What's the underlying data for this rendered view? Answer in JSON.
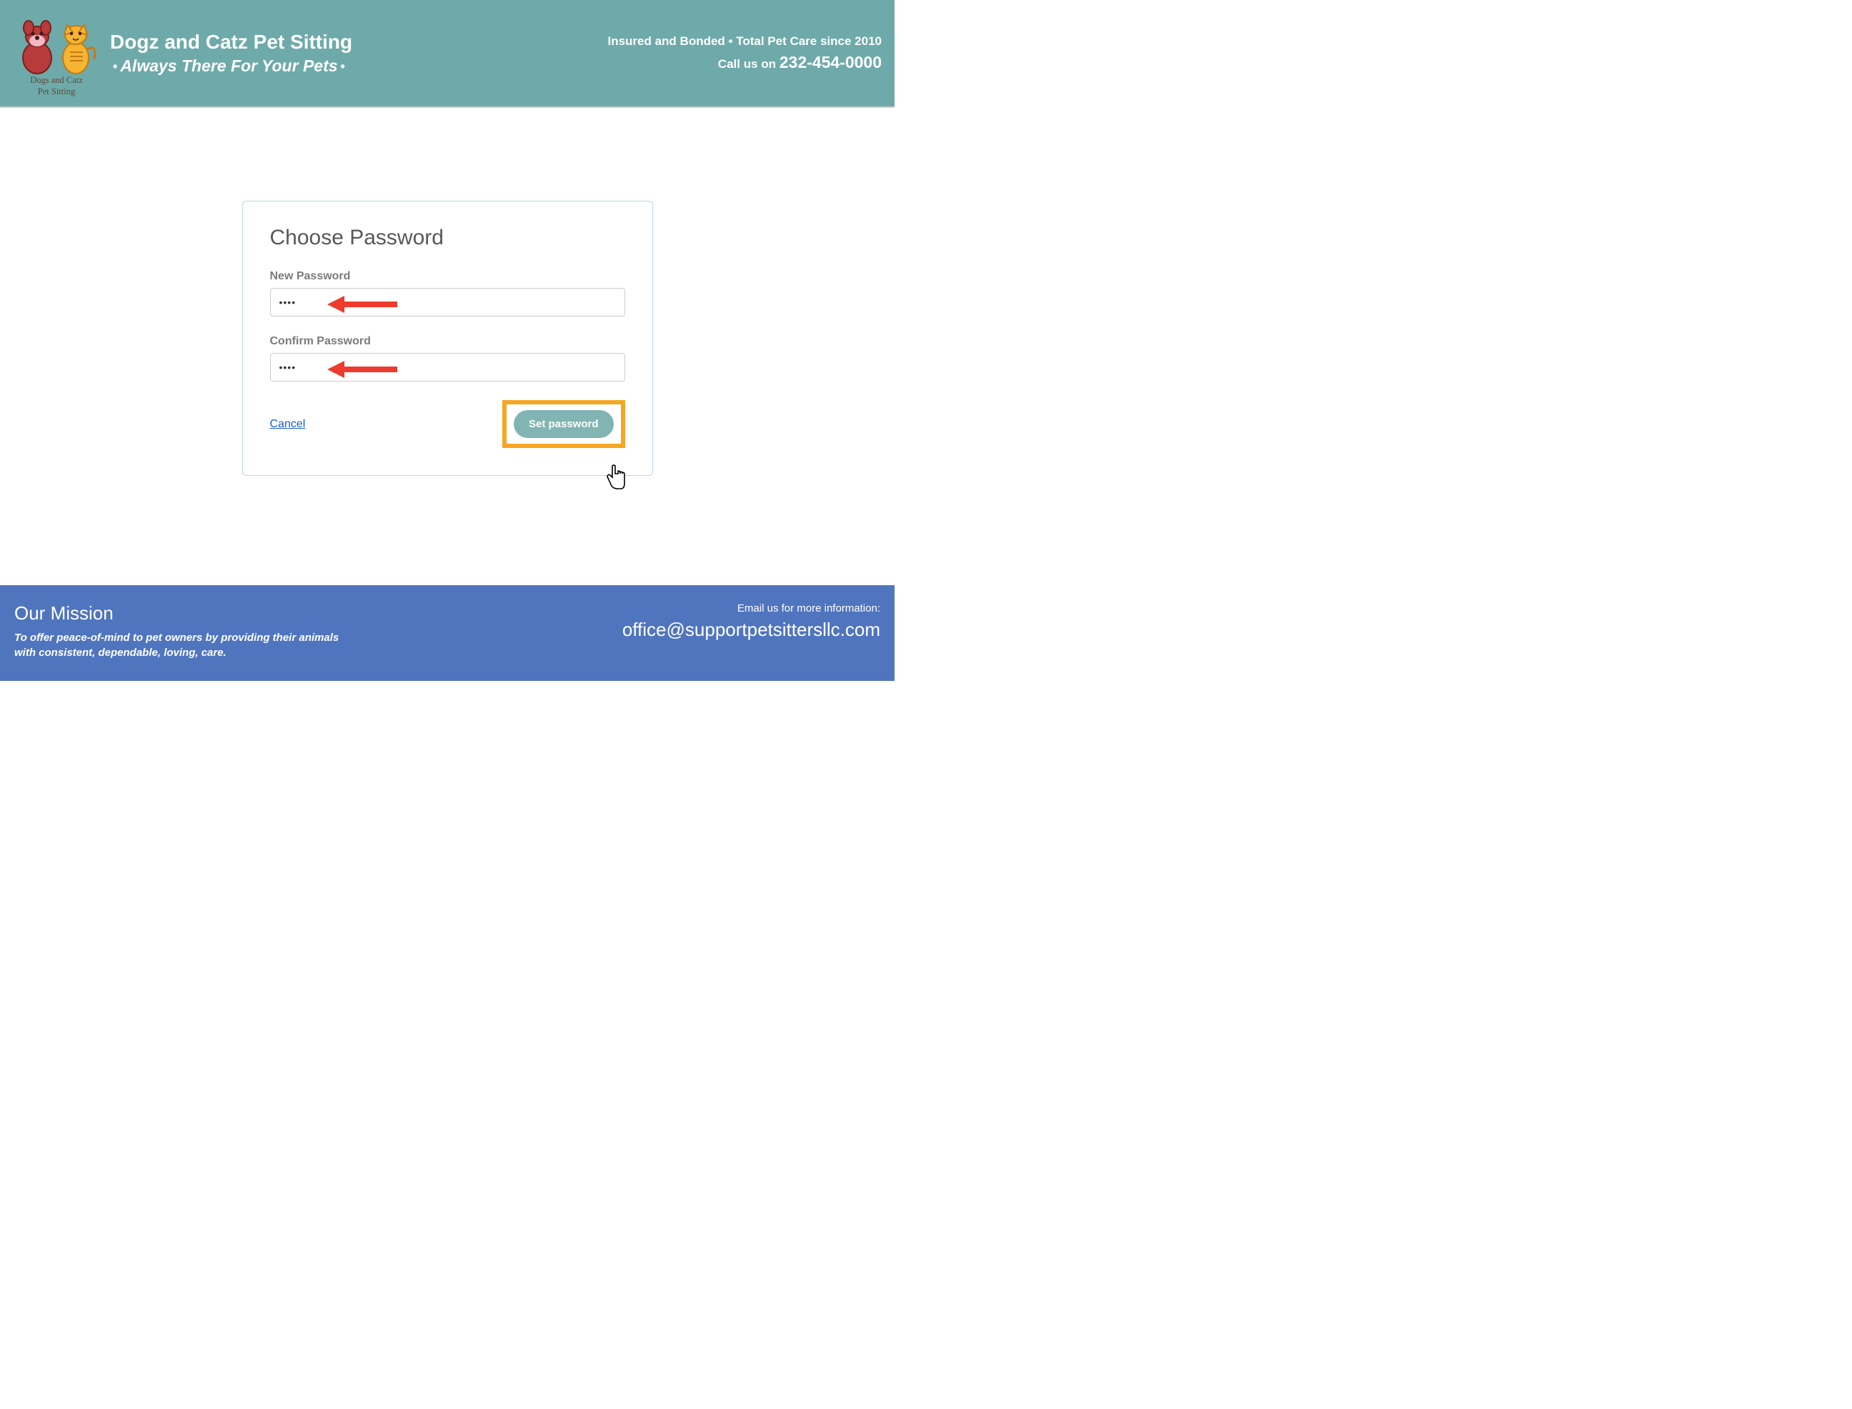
{
  "header": {
    "logo_line1": "Dogs and Catz",
    "logo_line2": "Pet Sitting",
    "brand_title": "Dogz and Catz Pet Sitting",
    "brand_tagline": "Always There For Your Pets",
    "tagline_right": "Insured and Bonded • Total Pet Care since 2010",
    "call_label": "Call us on ",
    "phone": "232-454-0000"
  },
  "form": {
    "title": "Choose Password",
    "new_password_label": "New Password",
    "new_password_value": "••••",
    "confirm_password_label": "Confirm Password",
    "confirm_password_value": "••••",
    "cancel_label": "Cancel",
    "submit_label": "Set password"
  },
  "footer": {
    "mission_title": "Our Mission",
    "mission_text_line1": "To offer peace-of-mind to pet owners by providing their animals",
    "mission_text_line2": "with consistent, dependable, loving, care.",
    "email_label": "Email us for more information:",
    "email": "office@supportpetsittersllc.com"
  }
}
